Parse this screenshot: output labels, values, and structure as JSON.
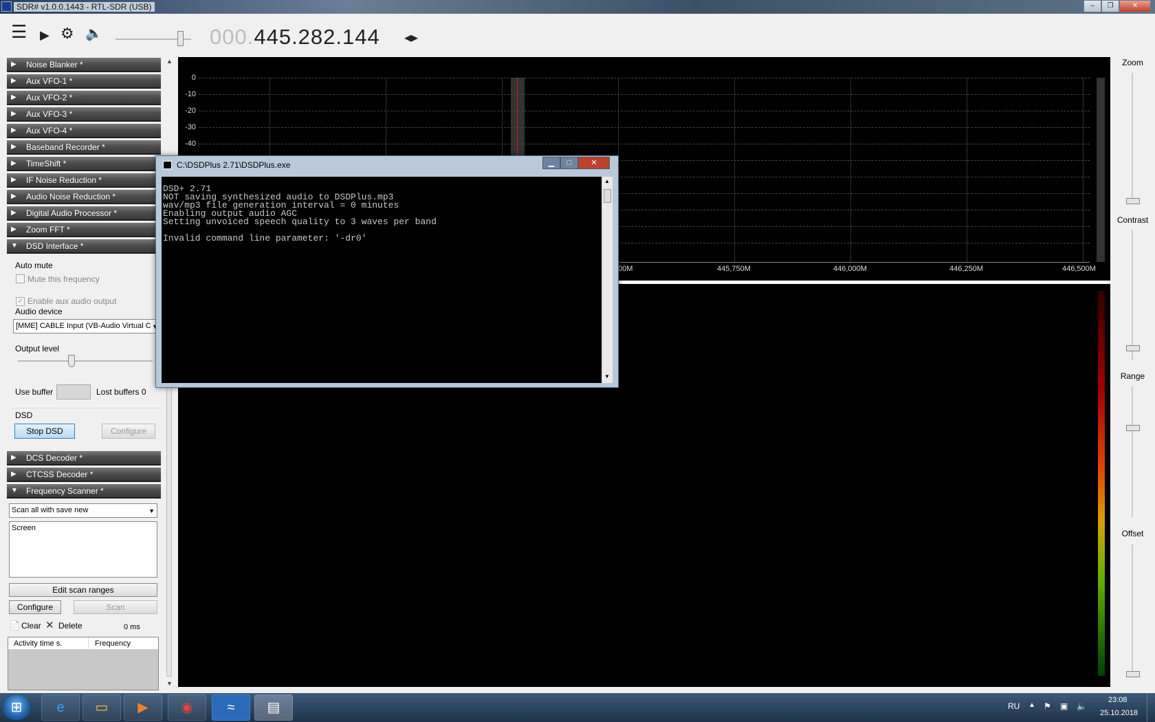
{
  "window": {
    "title": "SDR# v1.0.0.1443 - RTL-SDR (USB)",
    "minimize": "–",
    "restore": "❐",
    "close": "✕"
  },
  "toolbar": {
    "menu_icon": "☰",
    "play_icon": "▶",
    "settings_icon": "⚙",
    "volume_icon": "🔈",
    "volume_level": 0.85,
    "freq_dim": "000.",
    "freq_main": "445.282.144",
    "freq_arrows": "◂▸"
  },
  "sidebar": {
    "panels_top": [
      {
        "label": "Noise Blanker *",
        "expanded": false
      },
      {
        "label": "Aux VFO-1 *",
        "expanded": false
      },
      {
        "label": "Aux VFO-2 *",
        "expanded": false
      },
      {
        "label": "Aux VFO-3 *",
        "expanded": false
      },
      {
        "label": "Aux VFO-4 *",
        "expanded": false
      },
      {
        "label": "Baseband Recorder *",
        "expanded": false
      },
      {
        "label": "TimeShift *",
        "expanded": false
      },
      {
        "label": "IF Noise Reduction *",
        "expanded": false
      },
      {
        "label": "Audio Noise Reduction *",
        "expanded": false
      },
      {
        "label": "Digital Audio Processor *",
        "expanded": false
      },
      {
        "label": "Zoom FFT *",
        "expanded": false
      },
      {
        "label": "DSD Interface *",
        "expanded": true
      }
    ],
    "dsd": {
      "auto_mute": "Auto mute",
      "mute_freq": "Mute this frequency",
      "enable_aux": "Enable aux audio output",
      "audio_device_label": "Audio device",
      "audio_device_value": "[MME] CABLE Input (VB-Audio Virtual C",
      "output_level": "Output level",
      "output_level_value": 0.4,
      "use_buffer": "Use buffer",
      "lost_buffers": "Lost buffers 0",
      "group": "DSD",
      "stop_btn": "Stop DSD",
      "configure_btn": "Configure"
    },
    "panels_bottom": [
      {
        "label": "DCS Decoder *",
        "expanded": false
      },
      {
        "label": "CTCSS Decoder *",
        "expanded": false
      },
      {
        "label": "Frequency Scanner *",
        "expanded": true
      }
    ],
    "scanner": {
      "mode": "Scan all with save new",
      "list_item": "Screen",
      "edit_ranges": "Edit scan ranges",
      "configure": "Configure",
      "scan": "Scan",
      "clear": "Clear",
      "delete": "Delete",
      "ms": "0 ms",
      "col_activity": "Activity time s.",
      "col_frequency": "Frequency"
    }
  },
  "spectrum": {
    "y_ticks": [
      "0",
      "-10",
      "-20",
      "-30",
      "-40"
    ],
    "x_ticks": [
      "00M",
      "445,750M",
      "446,000M",
      "446,250M",
      "446,500M"
    ]
  },
  "rightpanel": {
    "zoom": "Zoom",
    "contrast": "Contrast",
    "range": "Range",
    "offset": "Offset"
  },
  "console": {
    "title": "C:\\DSDPlus 2.71\\DSDPlus.exe",
    "text": "DSD+ 2.71\nNOT saving synthesized audio to DSDPlus.mp3\nwav/mp3 file generation interval = 0 minutes\nEnabling output audio AGC\nSetting unvoiced speech quality to 3 waves per band\n\nInvalid command line parameter: '-dr0'"
  },
  "taskbar": {
    "lang": "RU",
    "time": "23:08",
    "date": "25.10.2018"
  }
}
